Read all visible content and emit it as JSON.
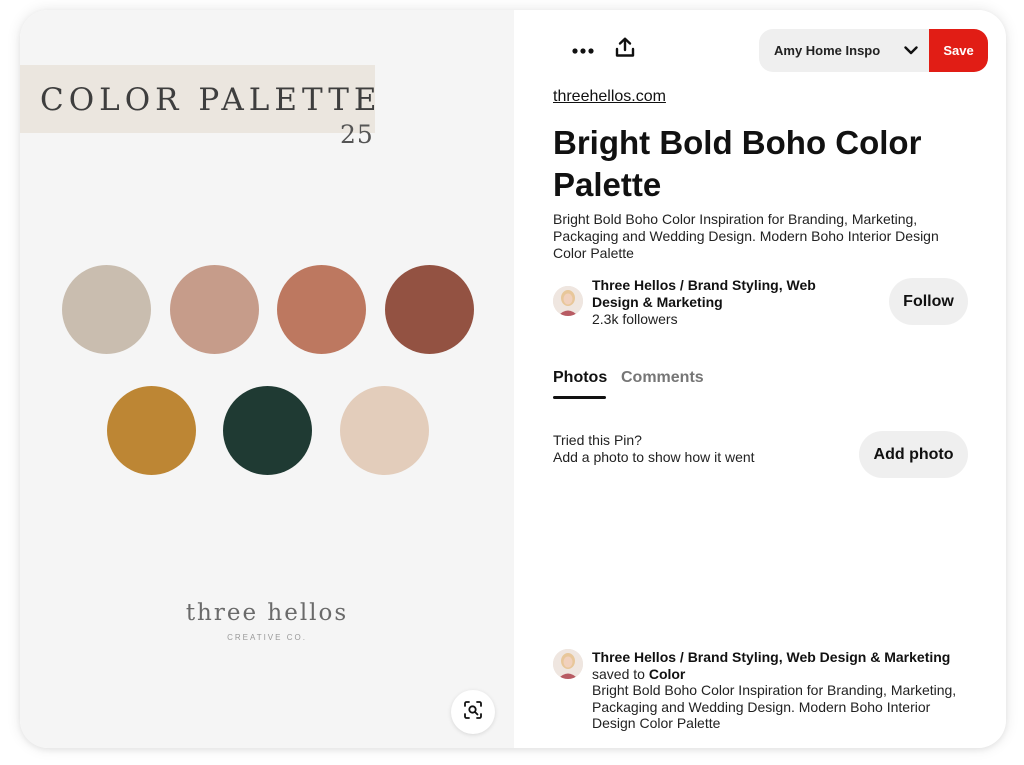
{
  "pin_image": {
    "title": "COLOR PALETTE",
    "number": "25",
    "swatch_colors": [
      "#c9bdaf",
      "#c69c8a",
      "#bd7860",
      "#935242",
      "#bd8634",
      "#1f3a33",
      "#e3cdbb"
    ],
    "brand_wordmark": "three hellos",
    "brand_tagline": "CREATIVE CO."
  },
  "toolbar": {
    "more_icon": "more-icon",
    "share_icon": "share-icon",
    "board_name": "Amy Home Inspo",
    "save_label": "Save",
    "save_color": "#e11d15"
  },
  "pin": {
    "source": "threehellos.com",
    "title": "Bright Bold Boho Color Palette",
    "description": "Bright Bold Boho Color Inspiration for Branding, Marketing, Packaging and Wedding Design. Modern Boho Interior Design Color Palette"
  },
  "creator": {
    "name": "Three Hellos / Brand Styling, Web Design & Marketing",
    "followers": "2.3k followers",
    "follow_label": "Follow"
  },
  "tabs": [
    {
      "label": "Photos",
      "active": true
    },
    {
      "label": "Comments",
      "active": false
    }
  ],
  "tried": {
    "title": "Tried this Pin?",
    "subtitle": "Add a photo to show how it went",
    "button_label": "Add photo"
  },
  "saved_by": {
    "name": "Three Hellos / Brand Styling, Web Design & Marketing",
    "saved_to_prefix": "saved to",
    "board": "Color",
    "description": "Bright Bold Boho Color Inspiration for Branding, Marketing, Packaging and Wedding Design. Modern Boho Interior Design Color Palette"
  }
}
